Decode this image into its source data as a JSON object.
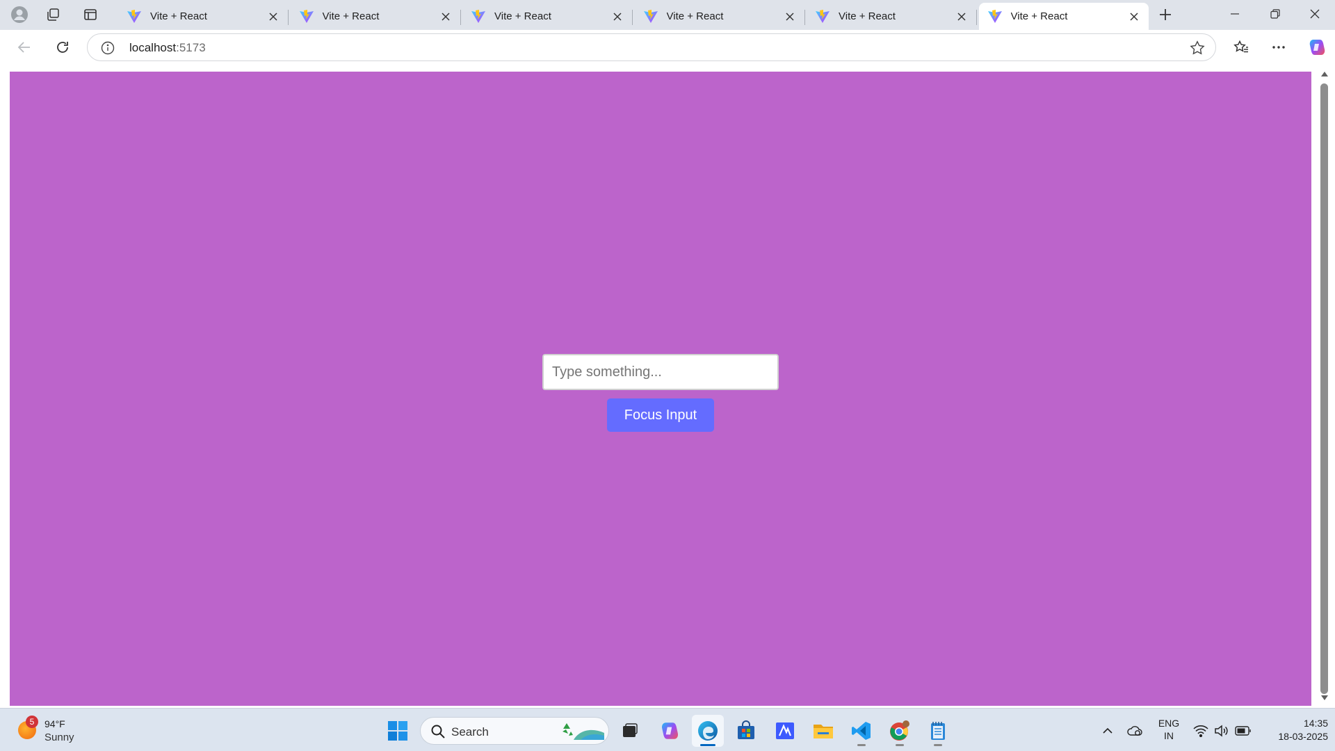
{
  "browser": {
    "tabs": [
      {
        "title": "Vite + React",
        "active": false
      },
      {
        "title": "Vite + React",
        "active": false
      },
      {
        "title": "Vite + React",
        "active": false
      },
      {
        "title": "Vite + React",
        "active": false
      },
      {
        "title": "Vite + React",
        "active": false
      },
      {
        "title": "Vite + React",
        "active": true
      }
    ],
    "address": {
      "host": "localhost",
      "port": ":5173"
    }
  },
  "app": {
    "background_color": "#bc64cb",
    "input_placeholder": "Type something...",
    "input_value": "",
    "button_label": "Focus Input",
    "button_color": "#646cff"
  },
  "taskbar": {
    "weather": {
      "badge": "5",
      "temperature": "94°F",
      "condition": "Sunny"
    },
    "search_label": "Search",
    "language": {
      "line1": "ENG",
      "line2": "IN"
    },
    "clock": {
      "time": "14:35",
      "date": "18-03-2025"
    },
    "pinned_apps": [
      "start-icon",
      "search",
      "task-view-icon",
      "copilot-icon",
      "edge-icon",
      "store-icon",
      "vscode-insiders-icon",
      "file-explorer-icon",
      "vscode-icon",
      "chrome-icon",
      "notepad-icon"
    ]
  }
}
